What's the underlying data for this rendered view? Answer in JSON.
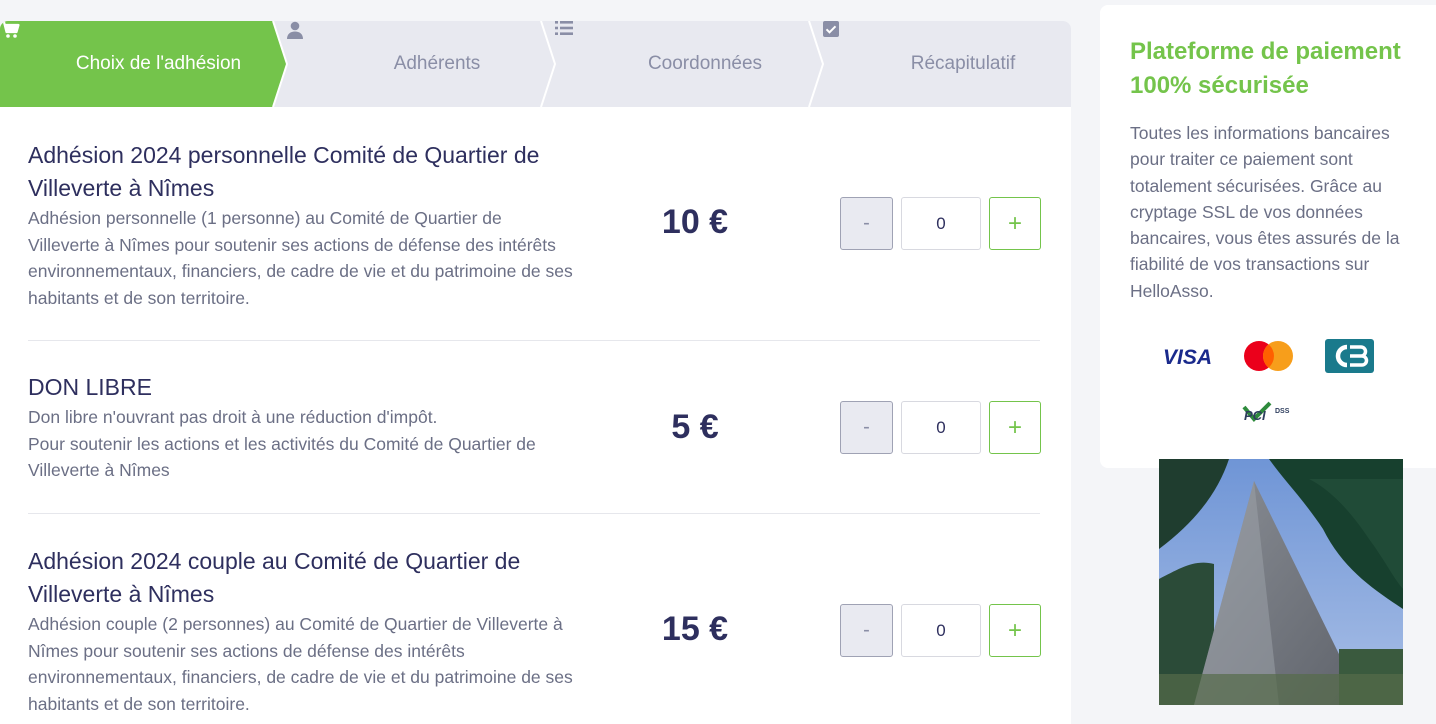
{
  "stepper": {
    "steps": [
      {
        "label": "Choix de l'adhésion",
        "icon": "cart-icon",
        "active": true
      },
      {
        "label": "Adhérents",
        "icon": "user-icon",
        "active": false
      },
      {
        "label": "Coordonnées",
        "icon": "list-icon",
        "active": false
      },
      {
        "label": "Récapitulatif",
        "icon": "checkbox-icon",
        "active": false
      }
    ]
  },
  "products": [
    {
      "title": "Adhésion 2024 personnelle Comité de Quartier de Villeverte à Nîmes",
      "description": "Adhésion personnelle (1 personne) au Comité de Quartier de Villeverte à Nîmes pour soutenir ses actions de défense des intérêts environnementaux, financiers, de cadre de vie et du patrimoine de ses habitants et de son territoire.",
      "price": "10 €",
      "quantity": "0",
      "minus_label": "-",
      "plus_label": "+"
    },
    {
      "title": "DON LIBRE",
      "description": "Don libre n'ouvrant pas droit à une réduction d'impôt.\nPour soutenir les actions et les activités du Comité de Quartier de Villeverte à Nîmes",
      "price": "5 €",
      "quantity": "0",
      "minus_label": "-",
      "plus_label": "+"
    },
    {
      "title": "Adhésion 2024 couple au Comité de Quartier de Villeverte à Nîmes",
      "description": "Adhésion couple (2 personnes) au Comité de Quartier de Villeverte à Nîmes pour soutenir ses actions de défense des intérêts environnementaux, financiers, de cadre de vie et du patrimoine de ses habitants et de son territoire.",
      "price": "15 €",
      "quantity": "0",
      "minus_label": "-",
      "plus_label": "+"
    }
  ],
  "sidebar": {
    "title": "Plateforme de paiement 100% sécurisée",
    "text": "Toutes les informations bancaires pour traiter ce paiement sont totalement sécurisées. Grâce au cryptage SSL de vos données bancaires, vous êtes assurés de la fiabilité de vos transactions sur HelloAsso.",
    "logos": [
      "visa-logo",
      "mastercard-logo",
      "cb-logo",
      "pci-dss-logo"
    ],
    "visa_text": "VISA",
    "pci_text": "PCI",
    "dss_text": "DSS"
  },
  "colors": {
    "accent": "#74c44b",
    "text_dark": "#2e2f5e",
    "text_muted": "#6b6f85",
    "stepper_bg": "#e8e9f0"
  }
}
